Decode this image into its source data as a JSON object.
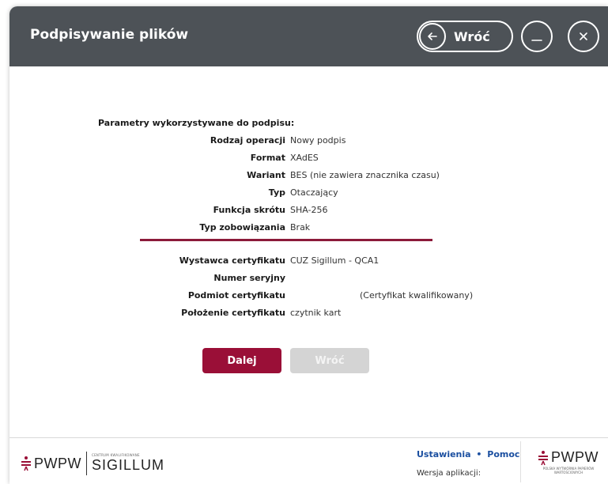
{
  "window": {
    "title": "Podpisywanie plików",
    "back_label": "Wróć",
    "minimize_symbol": "—",
    "close_symbol": "✕"
  },
  "params": {
    "heading": "Parametry wykorzystywane do podpisu:",
    "rows": [
      {
        "label": "Rodzaj operacji",
        "value": "Nowy podpis"
      },
      {
        "label": "Format",
        "value": "XAdES"
      },
      {
        "label": "Wariant",
        "value": "BES (nie zawiera znacznika czasu)"
      },
      {
        "label": "Typ",
        "value": "Otaczający"
      },
      {
        "label": "Funkcja skrótu",
        "value": "SHA-256"
      },
      {
        "label": "Typ zobowiązania",
        "value": "Brak"
      }
    ],
    "cert_rows": [
      {
        "label": "Wystawca certyfikatu",
        "value": "CUZ Sigillum - QCA1"
      },
      {
        "label": "Numer seryjny",
        "value": ""
      },
      {
        "label": "Podmiot certyfikatu",
        "value": "(Certyfikat kwalifikowany)"
      },
      {
        "label": "Położenie certyfikatu",
        "value": "czytnik kart"
      }
    ]
  },
  "actions": {
    "next_label": "Dalej",
    "back_label": "Wróć"
  },
  "footer": {
    "brand_left": "PWPW",
    "brand_sub": "CENTRUM KWALIFIKOWANE",
    "brand_product": "SIGILLUM",
    "settings_label": "Ustawienia",
    "separator": "•",
    "help_label": "Pomoc",
    "version_label": "Wersja aplikacji:",
    "brand_right": "PWPW",
    "brand_right_sub": "POLSKA WYTWÓRNIA PAPIERÓW WARTOŚCIOWYCH"
  },
  "colors": {
    "titlebar": "#4d5257",
    "accent": "#9a0f37",
    "divider": "#8b1a3a",
    "link": "#1b4fa0",
    "disabled": "#d4d4d4"
  }
}
